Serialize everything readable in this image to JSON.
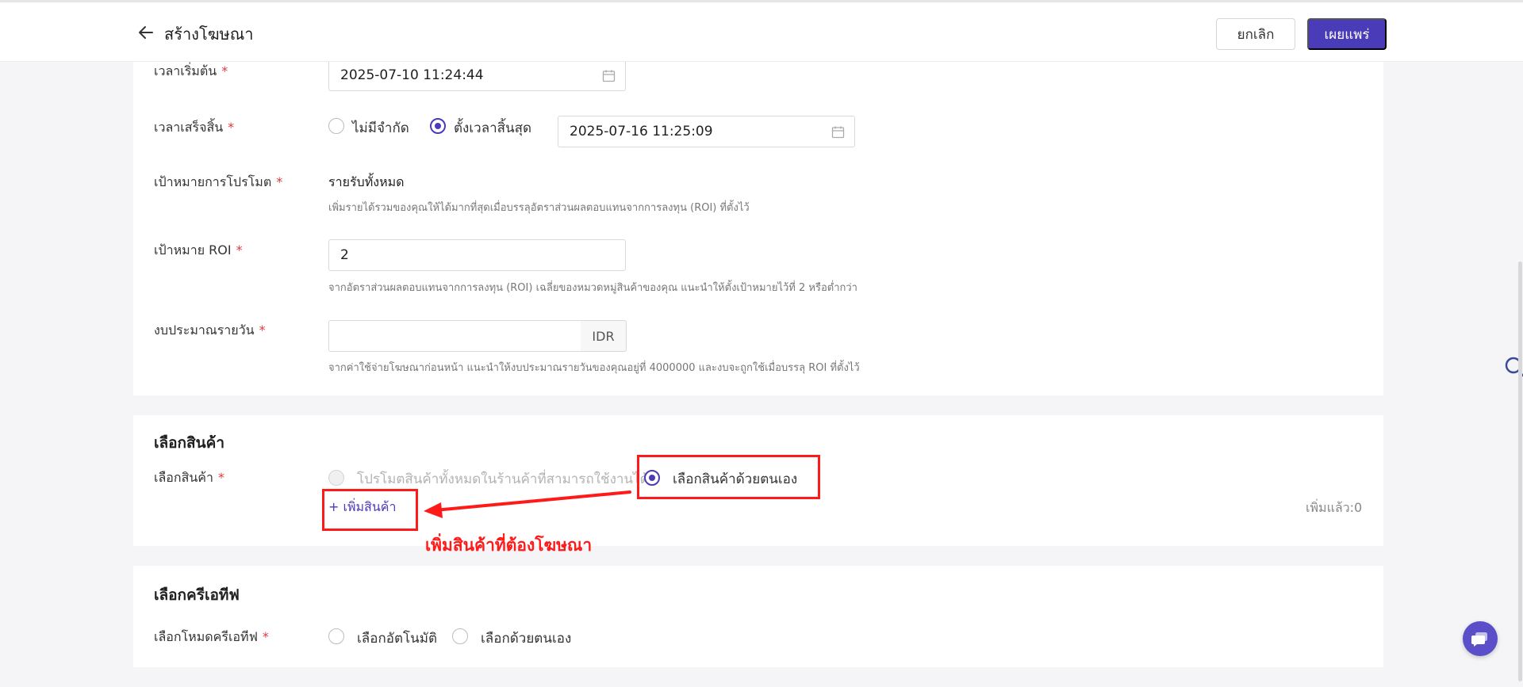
{
  "header": {
    "title": "สร้างโฆษณา",
    "cancel_label": "ยกเลิก",
    "publish_label": "เผยแพร่"
  },
  "schedule": {
    "start_label": "เวลาเริ่มต้น",
    "start_value": "2025-07-10 11:24:44",
    "end_label": "เวลาเสร็จสิ้น",
    "end_option_unlimited": "ไม่มีจำกัด",
    "end_option_set": "ตั้งเวลาสิ้นสุด",
    "end_value": "2025-07-16 11:25:09",
    "end_selected": "ตั้งเวลาสิ้นสุด"
  },
  "goal": {
    "label": "เป้าหมายการโปรโมต",
    "value": "รายรับทั้งหมด",
    "hint": "เพิ่มรายได้รวมของคุณให้ได้มากที่สุดเมื่อบรรลุอัตราส่วนผลตอบแทนจากการลงทุน (ROI) ที่ตั้งไว้"
  },
  "roi": {
    "label": "เป้าหมาย ROI",
    "value": "2",
    "hint": "จากอัตราส่วนผลตอบแทนจากการลงทุน (ROI) เฉลี่ยของหมวดหมู่สินค้าของคุณ แนะนำให้ตั้งเป้าหมายไว้ที่ 2 หรือต่ำกว่า"
  },
  "budget": {
    "label": "งบประมาณรายวัน",
    "value": "",
    "currency": "IDR",
    "hint": "จากค่าใช้จ่ายโฆษณาก่อนหน้า แนะนำให้งบประมาณรายวันของคุณอยู่ที่ 4000000 และงบจะถูกใช้เมื่อบรรลุ ROI ที่ตั้งไว้"
  },
  "products": {
    "section_title": "เลือกสินค้า",
    "label": "เลือกสินค้า",
    "option_all": "โปรโมตสินค้าทั้งหมดในร้านค้าที่สามารถใช้งานได้",
    "option_manual": "เลือกสินค้าด้วยตนเอง",
    "selected": "เลือกสินค้าด้วยตนเอง",
    "add_label": "+ เพิ่มสินค้า",
    "added_count": "เพิ่มแล้ว:0"
  },
  "creative": {
    "section_title": "เลือกครีเอทีฟ",
    "label": "เลือกโหมดครีเอทีฟ",
    "option_auto": "เลือกอัตโนมัติ",
    "option_manual": "เลือกด้วยตนเอง"
  },
  "annotation": {
    "text": "เพิ่มสินค้าที่ต้องโฆษณา"
  },
  "required_mark": "*",
  "colors": {
    "accent": "#4a3bb8",
    "required": "#e0383e",
    "annotation": "#ff1a1a"
  }
}
